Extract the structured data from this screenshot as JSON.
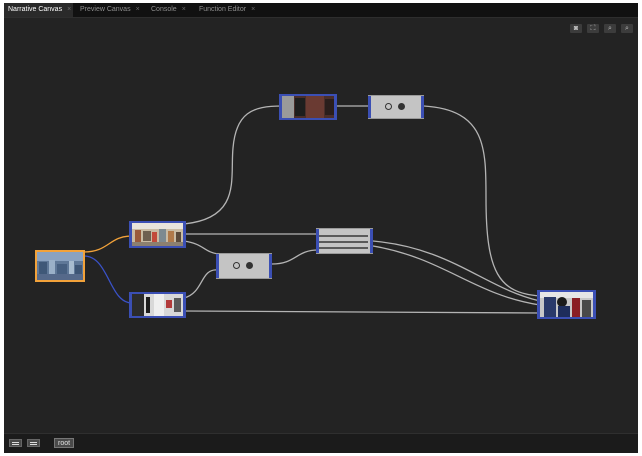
{
  "tabs": [
    {
      "label": "Narrative Canvas",
      "active": true
    },
    {
      "label": "Preview Canvas",
      "active": false
    },
    {
      "label": "Console",
      "active": false
    },
    {
      "label": "Function Editor",
      "active": false
    }
  ],
  "tab_close_glyph": "×",
  "tools": [
    {
      "icon": "camera-icon",
      "glyph": "◙"
    },
    {
      "icon": "fit-to-screen-icon",
      "glyph": "⛶"
    },
    {
      "icon": "zoom-in-icon",
      "glyph": "⌕"
    },
    {
      "icon": "zoom-out-icon",
      "glyph": "⌕"
    }
  ],
  "bottom_bar": {
    "root_label": "root"
  },
  "colors": {
    "canvas_bg": "#232323",
    "port": "#3b4fb4",
    "edge": "#b4b4b4",
    "edge_orange": "#f2a23a",
    "edge_blue": "#3a52c8",
    "selected_border": "#f2a23a"
  },
  "nodes": [
    {
      "id": "source",
      "kind": "video-thumbnail",
      "scene": "aerial-city",
      "selected": true
    },
    {
      "id": "video-a",
      "kind": "video-thumbnail",
      "scene": "street-crowd"
    },
    {
      "id": "video-b",
      "kind": "video-thumbnail",
      "scene": "hallway-person"
    },
    {
      "id": "video-top",
      "kind": "video-thumbnail",
      "scene": "dark-room"
    },
    {
      "id": "video-out",
      "kind": "video-thumbnail",
      "scene": "two-people"
    },
    {
      "id": "choice-top",
      "kind": "choice-operator",
      "icon": "open-and-filled-circles-icon"
    },
    {
      "id": "choice-mid",
      "kind": "choice-operator",
      "icon": "open-and-filled-circles-icon"
    },
    {
      "id": "list-op",
      "kind": "list-operator",
      "icon": "three-bars-icon"
    }
  ]
}
